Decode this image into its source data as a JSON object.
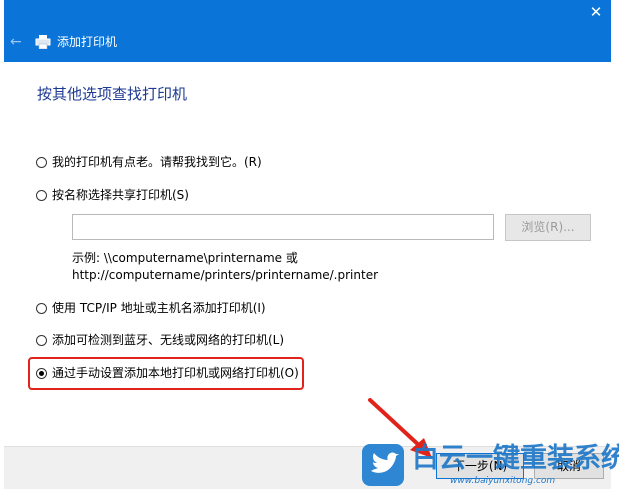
{
  "window": {
    "title": "添加打印机",
    "close_glyph": "✕",
    "back_glyph": "←"
  },
  "heading": "按其他选项查找打印机",
  "options": [
    {
      "label": "我的打印机有点老。请帮我找到它。(R)",
      "checked": false
    },
    {
      "label": "按名称选择共享打印机(S)",
      "checked": false
    },
    {
      "label": "使用 TCP/IP 地址或主机名添加打印机(I)",
      "checked": false
    },
    {
      "label": "添加可检测到蓝牙、无线或网络的打印机(L)",
      "checked": false
    },
    {
      "label": "通过手动设置添加本地打印机或网络打印机(O)",
      "checked": true
    }
  ],
  "share_input": {
    "value": ""
  },
  "browse_button": "浏览(R)...",
  "example_lines": [
    "示例: \\\\computername\\printername 或",
    "http://computername/printers/printername/.printer"
  ],
  "buttons": {
    "next": "下一步(N)",
    "cancel": "取消"
  },
  "watermark": {
    "text": "白云一键重装系统",
    "url": "www.baiyunxitong.com"
  },
  "colors": {
    "titlebar": "#0a74d8",
    "heading": "#1e3a93",
    "highlight": "#e0241b"
  }
}
